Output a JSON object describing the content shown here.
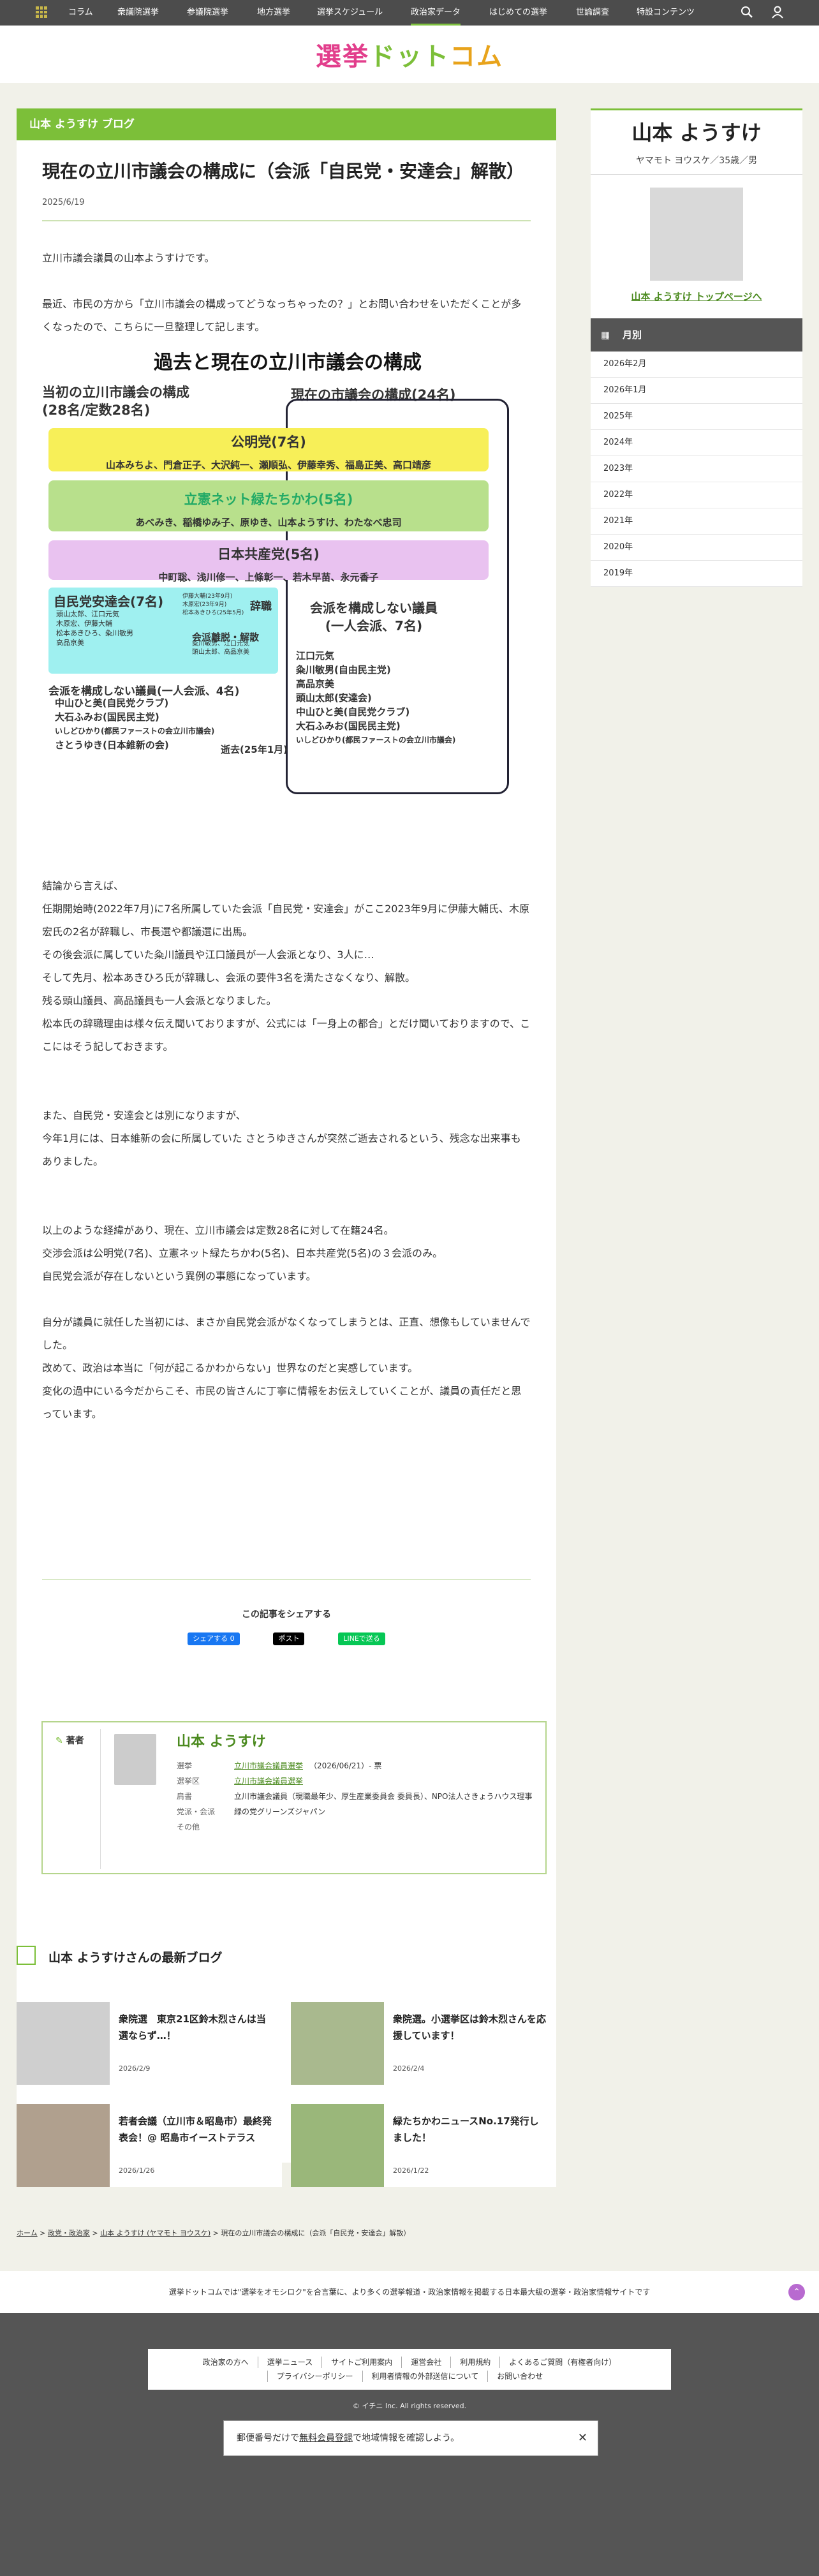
{
  "nav": {
    "items": [
      "コラム",
      "衆議院選挙",
      "参議院選挙",
      "地方選挙",
      "選挙スケジュール",
      "政治家データ",
      "はじめての選挙",
      "世論調査",
      "特設コンテンツ"
    ]
  },
  "logo": {
    "part1": "選挙",
    "part2": "ドット",
    "part3": "コム"
  },
  "blog": {
    "bar": "山本 ようすけ ブログ",
    "title": "現在の立川市議会の構成に（会派「自民党・安達会」解散）",
    "date": "2025/6/19",
    "paragraphs": [
      "立川市議会議員の山本ようすけです。",
      "",
      "最近、市民の方から「立川市議会の構成ってどうなっちゃったの？」とお問い合わせをいただくことが多くなったので、こちらに一旦整理して記します。"
    ],
    "paragraphs2": [
      "結論から言えば、",
      "任期開始時(2022年7月)に7名所属していた会派「自民党・安達会」がここ2023年9月に伊藤大輔氏、木原宏氏の2名が辞職し、市長選や都議選に出馬。",
      "その後会派に属していた粂川議員や江口議員が一人会派となり、3人に…",
      "そして先月、松本あきひろ氏が辞職し、会派の要件3名を満たさなくなり、解散。",
      "残る頭山議員、高品議員も一人会派となりました。",
      "松本氏の辞職理由は様々伝え聞いておりますが、公式には「一身上の都合」とだけ聞いておりますので、ここにはそう記しておきます。",
      "",
      "",
      "また、自民党・安達会とは別になりますが、",
      "今年1月には、日本維新の会に所属していた さとうゆきさんが突然ご逝去されるという、残念な出来事もありました。",
      "",
      "",
      "以上のような経緯があり、現在、立川市議会は定数28名に対して在籍24名。",
      "交渉会派は公明党(7名)、立憲ネット緑たちかわ(5名)、日本共産党(5名)の３会派のみ。",
      "自民党会派が存在しないという異例の事態になっています。",
      "",
      "自分が議員に就任した当初には、まさか自民党会派がなくなってしまうとは、正直、想像もしていませんでした。",
      "改めて、政治は本当に「何が起こるかわからない」世界なのだと実感しています。",
      "変化の過中にいる今だからこそ、市民の皆さんに丁寧に情報をお伝えしていくことが、議員の責任だと思っています。"
    ]
  },
  "figure": {
    "title": "過去と現在の立川市議会の構成",
    "left_head": "当初の立川市議会の構成",
    "left_sub": "(28名/定数28名)",
    "right_head": "現在の市議会の構成(24名)",
    "komei": "公明党(7名)",
    "komei_members": "山本みちよ、門倉正子、大沢純一、瀬順弘、伊藤幸秀、福島正美、高口靖彦",
    "rikken": "立憲ネット緑たちかわ(5名)",
    "rikken_members": "あべみき、稲橋ゆみ子、原ゆき、山本ようすけ、わたなべ忠司",
    "kyosan": "日本共産党(5名)",
    "kyosan_members": "中町聡、浅川修一、上條彰一、若木早苗、永元香子",
    "jimin": "自民党安達会(7名)",
    "jimin_members": [
      "頭山太郎、江口元気",
      "木原宏、伊藤大輔",
      "松本あきひろ、粂川敏男",
      "高品京美"
    ],
    "jimin_note": [
      "伊藤大輔(23年9月)",
      "木原宏(23年9月)",
      "松本あきひろ(25年5月)"
    ],
    "resign": "辞職",
    "dissolve": "会派離脱・解散",
    "dissolve_members": [
      "粂川敏男、江口元気",
      "頭山太郎、高品京美"
    ],
    "left_solo": "会派を構成しない議員(一人会派、4名)",
    "left_solo_members": [
      "中山ひと美(自民党クラブ)",
      "大石ふみお(国民民主党)",
      "いしどひかり(都民ファーストの会立川市議会)",
      "さとうゆき(日本維新の会)"
    ],
    "death": "逝去(25年1月)",
    "right_solo": "会派を構成しない議員",
    "right_solo_sub": "(一人会派、7名)",
    "right_solo_members": [
      "江口元気",
      "粂川敏男(自由民主党)",
      "高品京美",
      "頭山太郎(安達会)",
      "中山ひと美(自民党クラブ)",
      "大石ふみお(国民民主党)",
      "いしどひかり(都民ファーストの会立川市議会)"
    ]
  },
  "share": {
    "heading": "この記事をシェアする",
    "fb": "シェアする 0",
    "x": "ポスト",
    "line": "LINEで送る"
  },
  "author": {
    "label": "著者",
    "name": "山本 ようすけ",
    "rows": [
      {
        "k": "選挙",
        "v": "立川市議会議員選挙",
        "v2": "（2026/06/21）- 票"
      },
      {
        "k": "選挙区",
        "v": "立川市議会議員選挙",
        "v2": ""
      },
      {
        "k": "肩書",
        "v": "立川市議会議員（現職最年少、厚生産業委員会 委員長）、NPO法人さきょうハウス理事",
        "v2": ""
      },
      {
        "k": "党派・会派",
        "v": "緑の党グリーンズジャパン",
        "v2": ""
      },
      {
        "k": "その他",
        "v": "",
        "v2": ""
      }
    ]
  },
  "sidebar": {
    "name": "山本 ようすけ",
    "kana": "ヤマモト ヨウスケ／35歳／男",
    "toplink": "山本 ようすけ トップページへ",
    "month_head": "月別",
    "months": [
      "2026年2月",
      "2026年1月",
      "2025年",
      "2024年",
      "2023年",
      "2022年",
      "2021年",
      "2020年",
      "2019年"
    ]
  },
  "latest": {
    "heading": "山本 ようすけさんの最新ブログ",
    "cards": [
      {
        "title": "衆院選　東京21区鈴木烈さんは当選ならず…！",
        "date": "2026/2/9"
      },
      {
        "title": "衆院選。小選挙区は鈴木烈さんを応援しています！",
        "date": "2026/2/4"
      },
      {
        "title": "若者会議（立川市＆昭島市）最終発表会！@ 昭島市イーストテラス",
        "date": "2026/1/26"
      },
      {
        "title": "緑たちかわニュースNo.17発行しました！",
        "date": "2026/1/22"
      }
    ]
  },
  "breadcrumb": [
    "ホーム",
    "政党・政治家",
    "山本 ようすけ (ヤマモト ヨウスケ)",
    "現在の立川市議会の構成に（会派「自民党・安達会」解散）"
  ],
  "footer": {
    "tagline": "選挙ドットコムでは\"選挙をオモシロク\"を合言葉に、より多くの選挙報道・政治家情報を掲載する日本最大級の選挙・政治家情報サイトです",
    "links": [
      "政治家の方へ",
      "選挙ニュース",
      "サイトご利用案内",
      "運営会社",
      "利用規約",
      "よくあるご質問（有権者向け）",
      "プライバシーポリシー",
      "利用者情報の外部送信について",
      "お問い合わせ"
    ],
    "copyright": "© イチニ Inc. All rights reserved.",
    "notice_pre": "郵便番号だけで",
    "notice_link": "無料会員登録",
    "notice_post": "で地域情報を確認しよう。"
  },
  "colors": {
    "accent": "#7cbf39",
    "nav": "#4c4c4c",
    "komei": "#f7ef58",
    "rikken": "#b8e08c",
    "kyosan": "#e9c2f0",
    "jimin": "#9ff0f0"
  }
}
